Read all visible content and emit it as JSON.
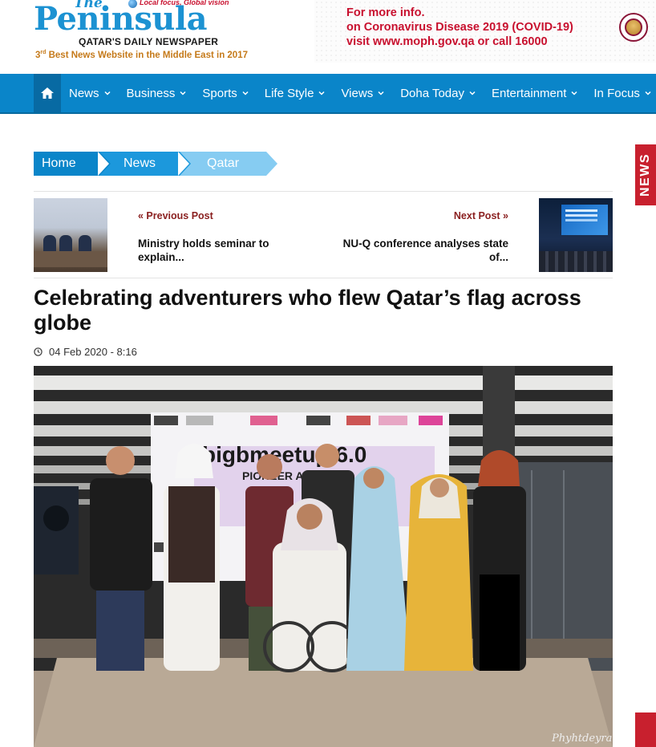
{
  "header": {
    "logo": {
      "the": "The",
      "name": "Peninsula",
      "tagline": "Local focus, Global vision",
      "subtitle": "QATAR'S DAILY NEWSPAPER",
      "award_rank": "3",
      "award_suffix": "rd",
      "award_text": " Best News Website in the Middle East in 2017"
    },
    "covid_banner": {
      "line1": "For more info.",
      "line2": "on Coronavirus Disease 2019 (COVID-19)",
      "line3": "visit www.moph.gov.qa or call 16000"
    }
  },
  "nav": {
    "home_icon": "home-icon",
    "items": [
      {
        "label": "News"
      },
      {
        "label": "Business"
      },
      {
        "label": "Sports"
      },
      {
        "label": "Life Style"
      },
      {
        "label": "Views"
      },
      {
        "label": "Doha Today"
      },
      {
        "label": "Entertainment"
      },
      {
        "label": "In Focus"
      }
    ]
  },
  "breadcrumb": {
    "home": "Home",
    "news": "News",
    "qatar": "Qatar"
  },
  "post_nav": {
    "previous_label": "« Previous Post",
    "previous_title": "Ministry holds seminar to explain...",
    "next_label": "Next Post »",
    "next_title": "NU-Q conference analyses state of..."
  },
  "article": {
    "headline": "Celebrating adventurers who flew Qatar’s flag across globe",
    "date": "04 Feb 2020 - 8:16",
    "photo": {
      "backdrop_text": "bigbmeetup 6.0",
      "backdrop_subtext": "PIONEER ARAB",
      "watermark": "Phyhtdeyrah"
    }
  },
  "side_tab": {
    "label": "NEWS"
  },
  "colors": {
    "brand_blue": "#1c92d2",
    "nav_blue": "#0a85c9",
    "accent_red": "#c8102e",
    "award_gold": "#c57a1a"
  }
}
